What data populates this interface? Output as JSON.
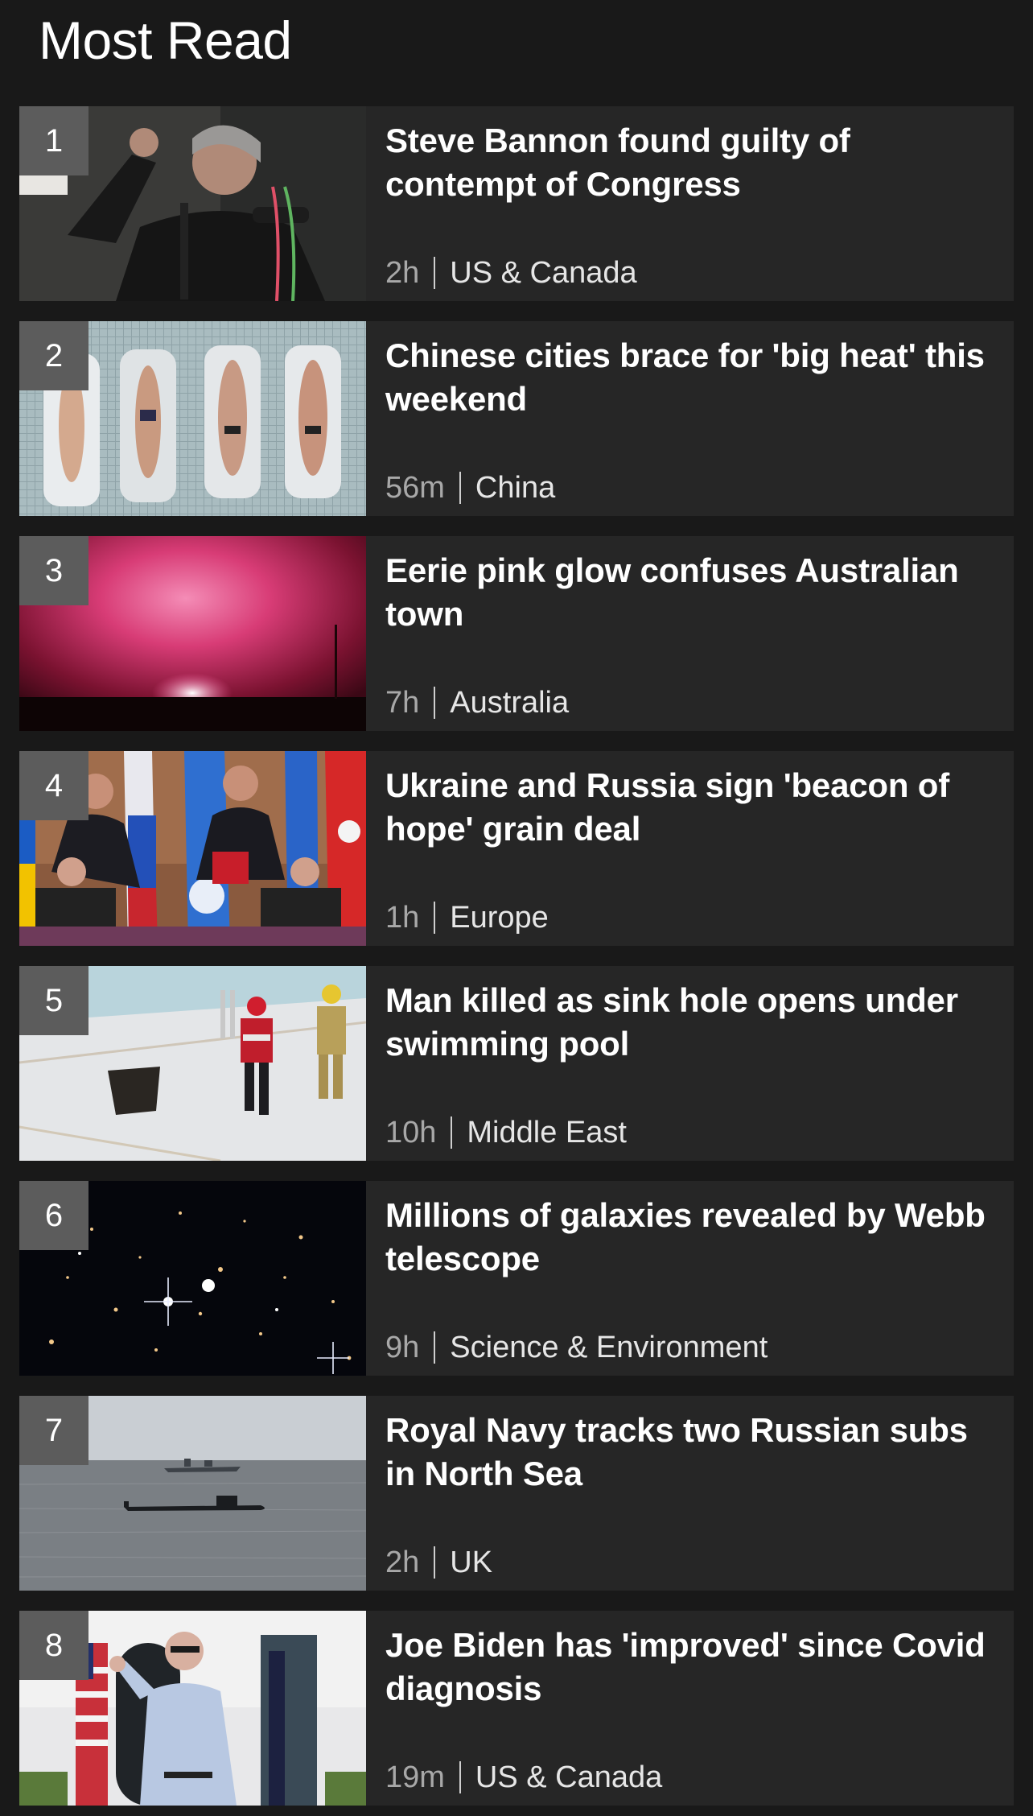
{
  "section": {
    "title": "Most Read"
  },
  "items": [
    {
      "rank": "1",
      "headline": "Steve Bannon found guilty of contempt of Congress",
      "time": "2h",
      "category": "US & Canada",
      "image_icon": "speaker-at-microphones-photo"
    },
    {
      "rank": "2",
      "headline": "Chinese cities brace for 'big heat' this weekend",
      "time": "56m",
      "category": "China",
      "image_icon": "sunbathers-on-tiles-photo"
    },
    {
      "rank": "3",
      "headline": "Eerie pink glow confuses Australian town",
      "time": "7h",
      "category": "Australia",
      "image_icon": "pink-sky-glow-photo"
    },
    {
      "rank": "4",
      "headline": "Ukraine and Russia sign 'beacon of hope' grain deal",
      "time": "1h",
      "category": "Europe",
      "image_icon": "signing-ceremony-flags-photo"
    },
    {
      "rank": "5",
      "headline": "Man killed as sink hole opens under swimming pool",
      "time": "10h",
      "category": "Middle East",
      "image_icon": "rescuers-in-pool-photo"
    },
    {
      "rank": "6",
      "headline": "Millions of galaxies revealed by Webb telescope",
      "time": "9h",
      "category": "Science & Environment",
      "image_icon": "deep-field-galaxies-photo"
    },
    {
      "rank": "7",
      "headline": "Royal Navy tracks two Russian subs in North Sea",
      "time": "2h",
      "category": "UK",
      "image_icon": "submarine-at-sea-photo"
    },
    {
      "rank": "8",
      "headline": "Joe Biden has 'improved' since Covid diagnosis",
      "time": "19m",
      "category": "US & Canada",
      "image_icon": "president-pointing-photo"
    }
  ],
  "colors": {
    "background": "#191919",
    "card": "#262626",
    "rank_badge": "#5c5c5c"
  }
}
